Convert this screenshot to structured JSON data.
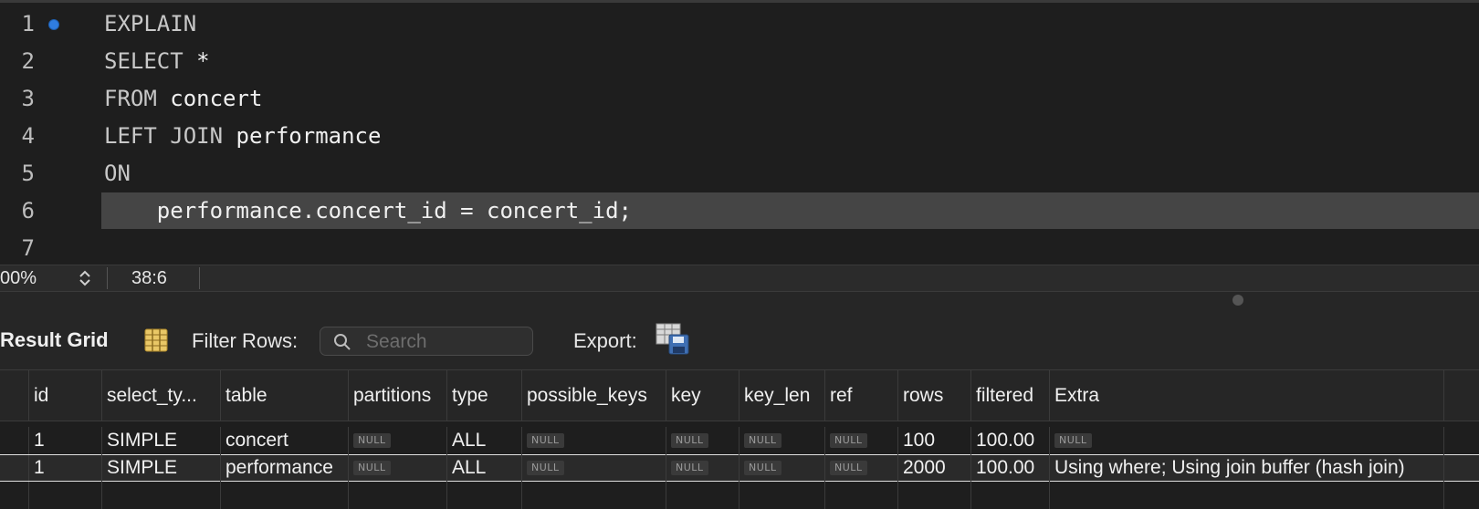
{
  "editor": {
    "lines": [
      {
        "num": "1",
        "kw": "EXPLAIN",
        "rest": ""
      },
      {
        "num": "2",
        "kw": "SELECT",
        "rest": " *"
      },
      {
        "num": "3",
        "kw": "FROM",
        "rest": " concert"
      },
      {
        "num": "4",
        "kw": "LEFT JOIN",
        "rest": " performance"
      },
      {
        "num": "5",
        "kw": "ON",
        "rest": ""
      },
      {
        "num": "6",
        "kw": "",
        "rest": "    performance.concert_id = concert_id;"
      },
      {
        "num": "7",
        "kw": "",
        "rest": ""
      }
    ],
    "marker_color": "#2f7de1",
    "current_line_bg": "#454545"
  },
  "statusbar": {
    "zoom": "00%",
    "position": "38:6"
  },
  "toolbar": {
    "result_grid_label": "Result Grid",
    "filter_label": "Filter Rows:",
    "search_placeholder": "Search",
    "export_label": "Export:"
  },
  "grid": {
    "headers": [
      "id",
      "select_ty...",
      "table",
      "partitions",
      "type",
      "possible_keys",
      "key",
      "key_len",
      "ref",
      "rows",
      "filtered",
      "Extra"
    ],
    "rows": [
      [
        "1",
        "SIMPLE",
        "concert",
        "NULL",
        "ALL",
        "NULL",
        "NULL",
        "NULL",
        "NULL",
        "100",
        "100.00",
        "NULL"
      ],
      [
        "1",
        "SIMPLE",
        "performance",
        "NULL",
        "ALL",
        "NULL",
        "NULL",
        "NULL",
        "NULL",
        "2000",
        "100.00",
        "Using where; Using join buffer (hash join)"
      ]
    ]
  }
}
